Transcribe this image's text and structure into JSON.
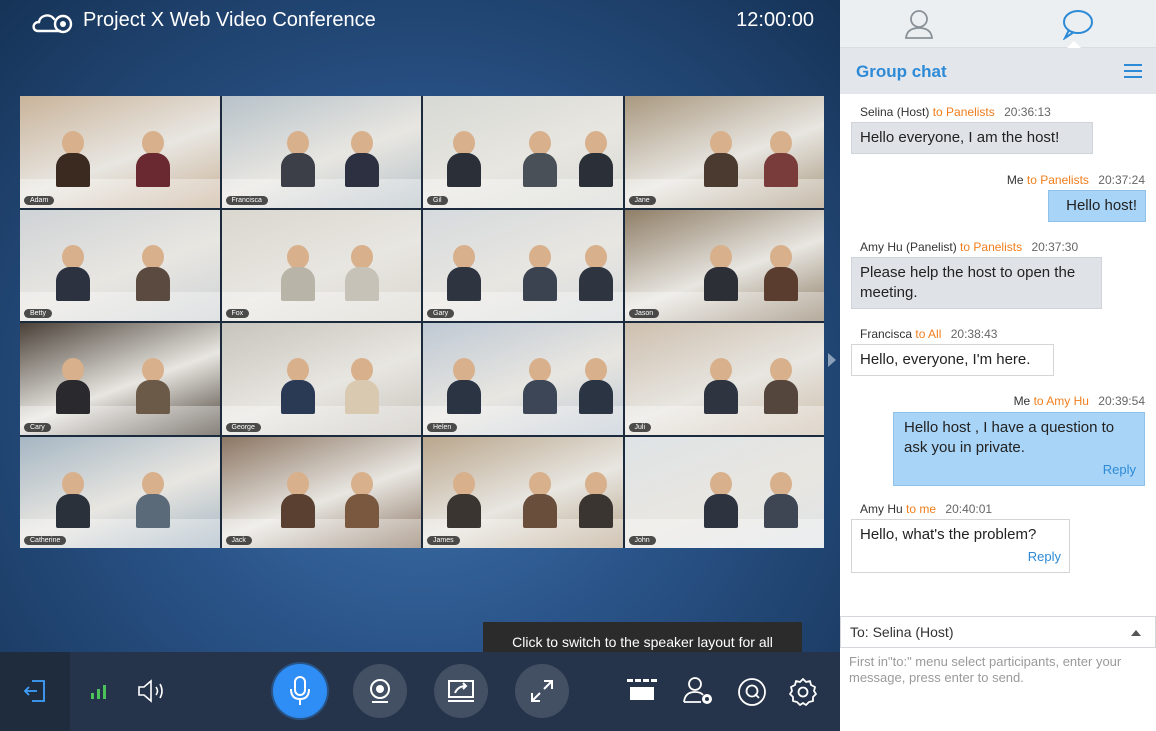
{
  "window": {
    "title": "Project X Web Video Conference",
    "clock": "12:00:00"
  },
  "participants": [
    {
      "name": "Adam",
      "bg": "#c9b39a",
      "p1": "#3b2a20",
      "p2": "#6a2830"
    },
    {
      "name": "Francisca",
      "bg": "#b7c2c9",
      "p1": "#3c3f48",
      "p2": "#2c3040"
    },
    {
      "name": "Gil",
      "bg": "#d7d9d4",
      "p1": "#2b3038",
      "p2": "#4a5058"
    },
    {
      "name": "Jane",
      "bg": "#a9987f",
      "p1": "#4b3a30",
      "p2": "#7a3b3b"
    },
    {
      "name": "Betty",
      "bg": "#cfd3d6",
      "p1": "#2c3240",
      "p2": "#5a4a40"
    },
    {
      "name": "Fox",
      "bg": "#dad7cf",
      "p1": "#b9b4a8",
      "p2": "#c7c2b7"
    },
    {
      "name": "Gary",
      "bg": "#d6dadd",
      "p1": "#2e3440",
      "p2": "#3b4250"
    },
    {
      "name": "Jason",
      "bg": "#8f7e67",
      "p1": "#2c2f36",
      "p2": "#5a3d2e"
    },
    {
      "name": "Cary",
      "bg": "#4a4138",
      "p1": "#2a2a2e",
      "p2": "#6b5a48"
    },
    {
      "name": "George",
      "bg": "#c8c4bd",
      "p1": "#2a3a55",
      "p2": "#d9c9b0"
    },
    {
      "name": "Helen",
      "bg": "#bfc9d4",
      "p1": "#2b3442",
      "p2": "#3c4656"
    },
    {
      "name": "Juli",
      "bg": "#cdbfae",
      "p1": "#2f3540",
      "p2": "#54463c"
    },
    {
      "name": "Catherine",
      "bg": "#a5b6c3",
      "p1": "#2b313b",
      "p2": "#5a6a78"
    },
    {
      "name": "Jack",
      "bg": "#8c7663",
      "p1": "#5a4030",
      "p2": "#7a5840"
    },
    {
      "name": "James",
      "bg": "#b9a68c",
      "p1": "#3a3530",
      "p2": "#6a4e3c"
    },
    {
      "name": "John",
      "bg": "#dfe3e6",
      "p1": "#2d3440",
      "p2": "#3e4654"
    }
  ],
  "tooltip": {
    "text": "Click to switch to the speaker layout for all"
  },
  "toolbar": {
    "icons": [
      "exit-icon",
      "signal-icon",
      "speaker-icon",
      "microphone-icon",
      "camera-icon",
      "screen-share-icon",
      "fullscreen-icon",
      "layout-icon",
      "participants-settings-icon",
      "qa-icon",
      "settings-icon"
    ]
  },
  "chat": {
    "title": "Group chat",
    "messages": [
      {
        "sender": "Selina (Host)",
        "to": "to Panelists",
        "time": "20:36:13",
        "text": "Hello everyone, I am the host!"
      },
      {
        "sender": "Me",
        "to": "to Panelists",
        "time": "20:37:24",
        "text": "Hello host!"
      },
      {
        "sender": "Amy Hu (Panelist)",
        "to": "to Panelists",
        "time": "20:37:30",
        "text": "Please help the host to open the meeting."
      },
      {
        "sender": "Francisca",
        "to": "to All",
        "time": "20:38:43",
        "text": "Hello, everyone, I'm here."
      },
      {
        "sender": "Me",
        "to": "to Amy Hu",
        "time": "20:39:54",
        "text": "Hello host , I have a question to ask you in private.",
        "reply": "Reply"
      },
      {
        "sender": "Amy  Hu",
        "to": "to me",
        "time": "20:40:01",
        "text": "Hello, what's the problem?",
        "reply": "Reply"
      }
    ],
    "recipient": "To: Selina (Host)",
    "compose_hint": "First in\"to:\" menu select participants, enter your message, press enter to send."
  },
  "colors": {
    "accent": "#2d8ad6",
    "recipient_highlight": "#f07e1c",
    "mic_active": "#2f8ef5"
  }
}
